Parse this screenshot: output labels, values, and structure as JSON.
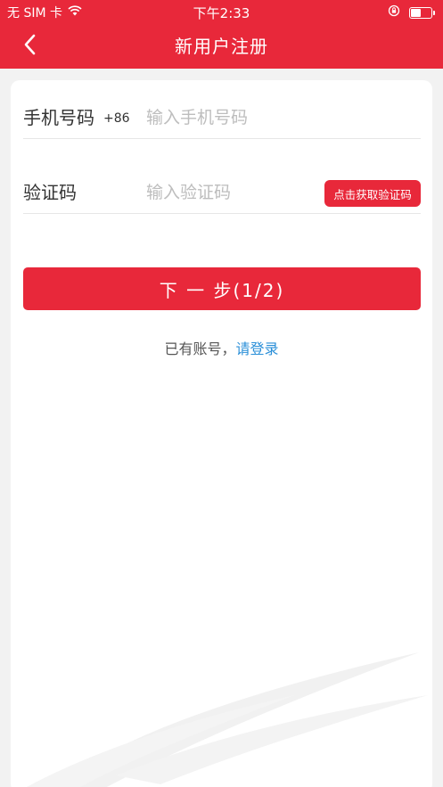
{
  "status_bar": {
    "carrier": "无 SIM 卡",
    "time": "下午2:33"
  },
  "nav": {
    "title": "新用户注册"
  },
  "form": {
    "phone": {
      "label": "手机号码",
      "prefix": "+86",
      "placeholder": "输入手机号码",
      "value": ""
    },
    "code": {
      "label": "验证码",
      "placeholder": "输入验证码",
      "value": "",
      "button_label": "点击获取验证码"
    },
    "next_button_label": "下 一 步(1/2)",
    "login_prompt": "已有账号，",
    "login_link": "请登录"
  },
  "colors": {
    "brand": "#e8283a",
    "link": "#2a8fd8"
  },
  "icons": {
    "back": "chevron-left-icon",
    "wifi": "wifi-icon",
    "orientation_lock": "orientation-lock-icon",
    "battery": "battery-icon"
  }
}
